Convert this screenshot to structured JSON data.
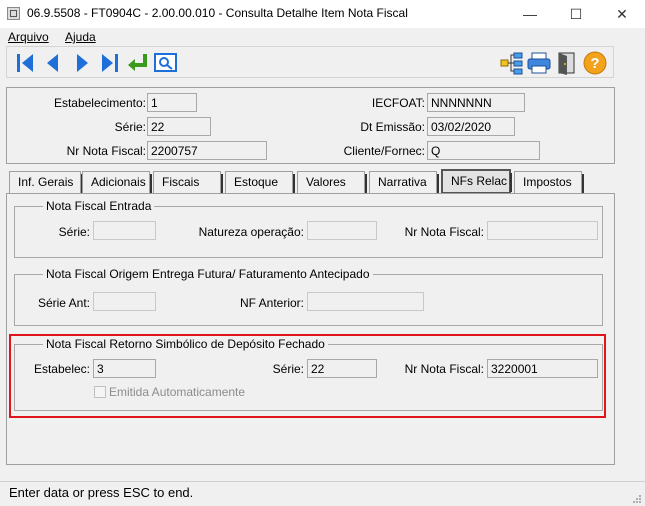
{
  "window": {
    "title": "06.9.5508 - FT0904C - 2.00.00.010 - Consulta Detalhe Item Nota Fiscal",
    "min_glyph": "—",
    "max_glyph": "☐",
    "close_glyph": "✕"
  },
  "menu": {
    "items": [
      "Arquivo",
      "Ajuda"
    ]
  },
  "toolbar": {
    "left_icons": [
      "first-record-icon",
      "prev-record-icon",
      "next-record-icon",
      "last-record-icon",
      "goto-icon",
      "search-icon"
    ],
    "right_icons": [
      "tree-icon",
      "print-icon",
      "exit-icon",
      "help-icon"
    ],
    "colors": {
      "nav_blue": "#1e6fd9",
      "goto_green": "#3a9a1c",
      "help_orange": "#f3a21b"
    }
  },
  "header": {
    "estabelecimento": {
      "label": "Estabelecimento:",
      "value": "1"
    },
    "serie": {
      "label": "Série:",
      "value": "22"
    },
    "nr_nota_fiscal": {
      "label": "Nr Nota Fiscal:",
      "value": "2200757"
    },
    "iecfoat": {
      "label": "IECFOAT:",
      "value": "NNNNNNN"
    },
    "dt_emissao": {
      "label": "Dt Emissão:",
      "value": "03/02/2020"
    },
    "cliente_fornec": {
      "label": "Cliente/Fornec:",
      "value": "Q"
    }
  },
  "tabs": [
    "Inf. Gerais",
    "Adicionais",
    "Fiscais",
    "Estoque",
    "Valores",
    "Narrativa",
    "NFs Relac",
    "Impostos"
  ],
  "active_tab": "NFs Relac",
  "nf_entrada": {
    "title": "Nota Fiscal Entrada",
    "serie_label": "Série:",
    "serie_value": "",
    "natureza_label": "Natureza operação:",
    "natureza_value": "",
    "nr_label": "Nr Nota Fiscal:",
    "nr_value": ""
  },
  "nf_origem": {
    "title": "Nota Fiscal Origem Entrega Futura/ Faturamento Antecipado",
    "serie_ant_label": "Série Ant:",
    "serie_ant_value": "",
    "nf_anterior_label": "NF Anterior:",
    "nf_anterior_value": ""
  },
  "nf_retorno": {
    "title": "Nota Fiscal Retorno Simbólico de Depósito Fechado",
    "estabelec_label": "Estabelec:",
    "estabelec_value": "3",
    "serie_label": "Série:",
    "serie_value": "22",
    "nr_label": "Nr Nota Fiscal:",
    "nr_value": "3220001",
    "checkbox_label": "Emitida Automaticamente",
    "checkbox_checked": false,
    "highlight_color": "#e0151c"
  },
  "status": {
    "text": "Enter data or press ESC to end."
  }
}
